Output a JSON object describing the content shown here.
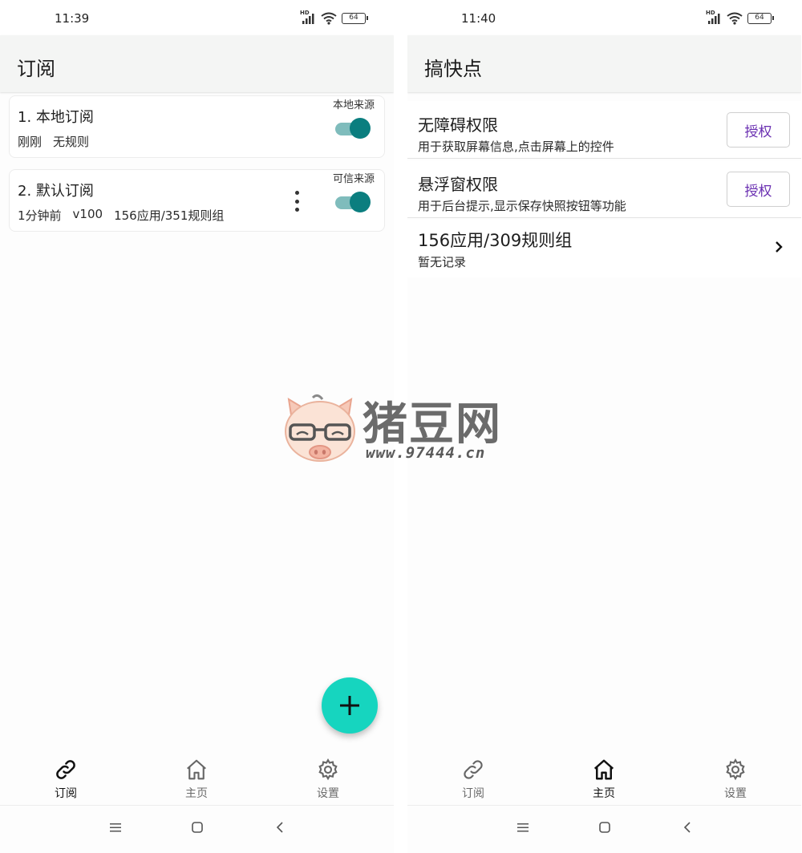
{
  "left": {
    "status": {
      "time": "11:39",
      "battery": "64"
    },
    "title": "订阅",
    "subscriptions": [
      {
        "name": "1. 本地订阅",
        "source": "本地来源",
        "meta": [
          "刚刚",
          "无规则"
        ]
      },
      {
        "name": "2. 默认订阅",
        "source": "可信来源",
        "meta": [
          "1分钟前",
          "v100",
          "156应用/351规则组"
        ]
      }
    ],
    "nav": {
      "subscribe": "订阅",
      "home": "主页",
      "settings": "设置",
      "active": "subscribe"
    }
  },
  "right": {
    "status": {
      "time": "11:40",
      "battery": "64"
    },
    "title": "搞快点",
    "permissions": [
      {
        "title": "无障碍权限",
        "desc": "用于获取屏幕信息,点击屏幕上的控件",
        "button": "授权"
      },
      {
        "title": "悬浮窗权限",
        "desc": "用于后台提示,显示保存快照按钮等功能",
        "button": "授权"
      }
    ],
    "rules": {
      "title": "156应用/309规则组",
      "desc": "暂无记录"
    },
    "nav": {
      "subscribe": "订阅",
      "home": "主页",
      "settings": "设置",
      "active": "home"
    }
  },
  "watermark": {
    "name": "猪豆网",
    "url": "www.97444.cn"
  },
  "colors": {
    "accent": "#0b7e7f",
    "fab": "#16d5bf",
    "grant": "#6a2fb1"
  },
  "icons": [
    "link-icon",
    "home-icon",
    "gear-icon",
    "plus-icon",
    "chevron-right-icon",
    "more-vert-icon",
    "wifi-icon",
    "signal-icon",
    "battery-icon"
  ]
}
